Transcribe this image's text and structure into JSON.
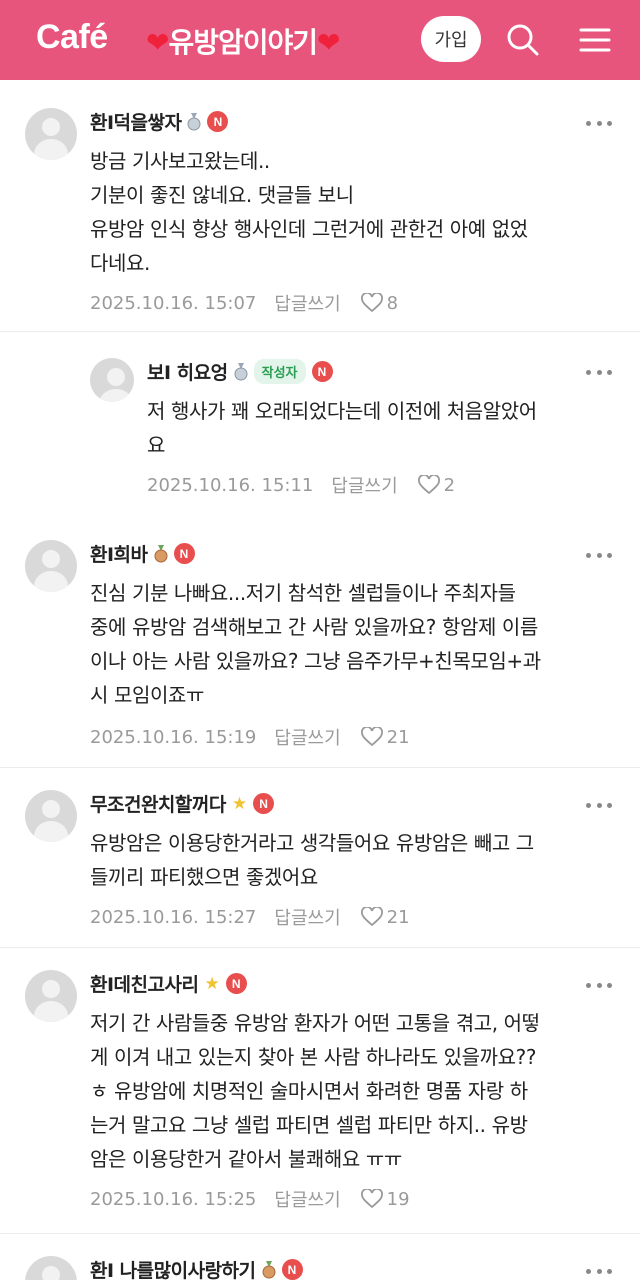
{
  "header": {
    "logo": "Café",
    "cafe_name": "유방암이야기",
    "join_label": "가입"
  },
  "icons": {
    "search": "search-icon",
    "menu": "hamburger-menu-icon",
    "more": "more-dots-icon",
    "like": "heart-outline-icon",
    "avatar": "default-profile-icon"
  },
  "colors": {
    "header_bg": "#e8557c",
    "n_badge": "#e94e4e",
    "writer_badge_bg": "#e3f5ea",
    "writer_badge_text": "#2a9d52"
  },
  "comments": [
    {
      "author": "환I덕을쌓자",
      "rank_icon": "silver-medal-icon",
      "badge": "N",
      "lines": [
        "방금 기사보고왔는데..",
        "기분이 좋진 않네요. 댓글들 보니",
        "유방암 인식 향상 행사인데 그런거에 관한건 아예 없었",
        "다네요."
      ],
      "date": "2025.10.16. 15:07",
      "reply_label": "답글쓰기",
      "likes": "8"
    },
    {
      "author": "보I 히요엉",
      "rank_icon": "silver-medal-icon",
      "writer_label": "작성자",
      "badge": "N",
      "lines": [
        "저 행사가 꽤 오래되었다는데 이전에 처음알았어",
        "요"
      ],
      "date": "2025.10.16. 15:11",
      "reply_label": "답글쓰기",
      "likes": "2"
    },
    {
      "author": "환I희바",
      "rank_icon": "bronze-medal-icon",
      "badge": "N",
      "lines": [
        "진심 기분 나빠요...저기 참석한 셀럽들이나 주최자들",
        "중에 유방암 검색해보고 간 사람 있을까요? 항암제 이름",
        "이나 아는 사람 있을까요? 그냥 음주가무+친목모임+과",
        "시 모임이죠ㅠ"
      ],
      "date": "2025.10.16. 15:19",
      "reply_label": "답글쓰기",
      "likes": "21"
    },
    {
      "author": "무조건완치할꺼다",
      "rank_icon": "star-icon",
      "badge": "N",
      "lines": [
        "유방암은 이용당한거라고 생각들어요 유방암은 빼고 그",
        "들끼리 파티했으면 좋겠어요"
      ],
      "date": "2025.10.16. 15:27",
      "reply_label": "답글쓰기",
      "likes": "21"
    },
    {
      "author": "환I데친고사리",
      "rank_icon": "star-icon",
      "badge": "N",
      "lines": [
        "저기 간 사람들중 유방암 환자가 어떤 고통을 겪고, 어떻",
        "게 이겨 내고 있는지 찾아 본 사람 하나라도 있을까요??",
        "ㅎ 유방암에 치명적인 술마시면서 화려한 명품 자랑 하",
        "는거 말고요 그냥 셀럽 파티면 셀럽 파티만 하지.. 유방",
        "암은 이용당한거 같아서 불쾌해요 ㅠㅠ"
      ],
      "date": "2025.10.16. 15:25",
      "reply_label": "답글쓰기",
      "likes": "19"
    },
    {
      "author": "환I 나를많이사랑하기",
      "rank_icon": "bronze-medal-icon",
      "badge": "N"
    }
  ]
}
